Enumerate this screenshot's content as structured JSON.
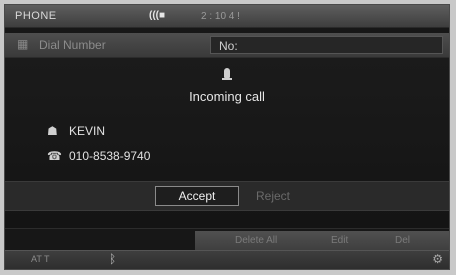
{
  "header": {
    "app_title": "PHONE",
    "signal": "(((■",
    "clock": "2 : 10 4 !"
  },
  "background": {
    "dial_label": "Dial Number",
    "number_value": "No:"
  },
  "dialog": {
    "title": "Incoming call",
    "caller_name": "KEVIN",
    "caller_number": "010-8538-9740",
    "accept_label": "Accept",
    "reject_label": "Reject"
  },
  "softkeys": [
    "Delete All",
    "Edit",
    "Del"
  ],
  "footer": {
    "left_text": "AT T"
  },
  "icons": {
    "dial": "keypad-icon",
    "ring": "ringing-phone-icon",
    "caller": "contact-icon",
    "number": "phone-number-icon",
    "bluetooth": "bluetooth-icon",
    "settings": "settings-icon"
  },
  "colors": {
    "background": "#171717",
    "bar": "#4a4a4a",
    "text": "#e6e6e6",
    "muted": "#6a6a6a"
  }
}
